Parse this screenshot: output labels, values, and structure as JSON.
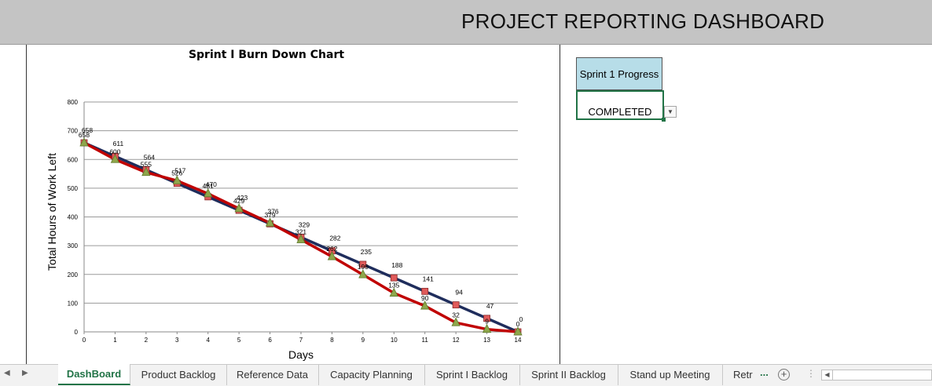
{
  "banner": {
    "title": "PROJECT REPORTING DASHBOARD"
  },
  "status": {
    "header": "Sprint 1 Progress",
    "value": "COMPLETED"
  },
  "sheet_tabs": [
    "DashBoard",
    "Product Backlog",
    "Reference Data",
    "Capacity Planning",
    "Sprint I Backlog",
    "Sprint II Backlog",
    "Stand up Meeting",
    "Retr"
  ],
  "active_tab": "DashBoard",
  "tab_more": "...",
  "colors": {
    "ideal_line": "#1f2d5c",
    "actual_line": "#c00000",
    "ideal_marker": "#e05a5a",
    "actual_marker": "#8fa64b",
    "header_fill": "#b7dde8",
    "accent": "#217346"
  },
  "chart_data": {
    "type": "line",
    "title": "Sprint I Burn Down Chart",
    "xlabel": "Days",
    "ylabel": "Total Hours of Work Left",
    "x": [
      0,
      1,
      2,
      3,
      4,
      5,
      6,
      7,
      8,
      9,
      10,
      11,
      12,
      13,
      14
    ],
    "ylim": [
      0,
      800
    ],
    "yticks": [
      0,
      100,
      200,
      300,
      400,
      500,
      600,
      700,
      800
    ],
    "grid": true,
    "legend": "none",
    "series": [
      {
        "marker": "square",
        "values": [
          658,
          611,
          564,
          517,
          470,
          423,
          376,
          329,
          282,
          235,
          188,
          141,
          94,
          47,
          0
        ]
      },
      {
        "marker": "triangle",
        "values": [
          658,
          600,
          555,
          526,
          481,
          429,
          379,
          321,
          262,
          199,
          135,
          90,
          32,
          9,
          0
        ]
      }
    ]
  }
}
